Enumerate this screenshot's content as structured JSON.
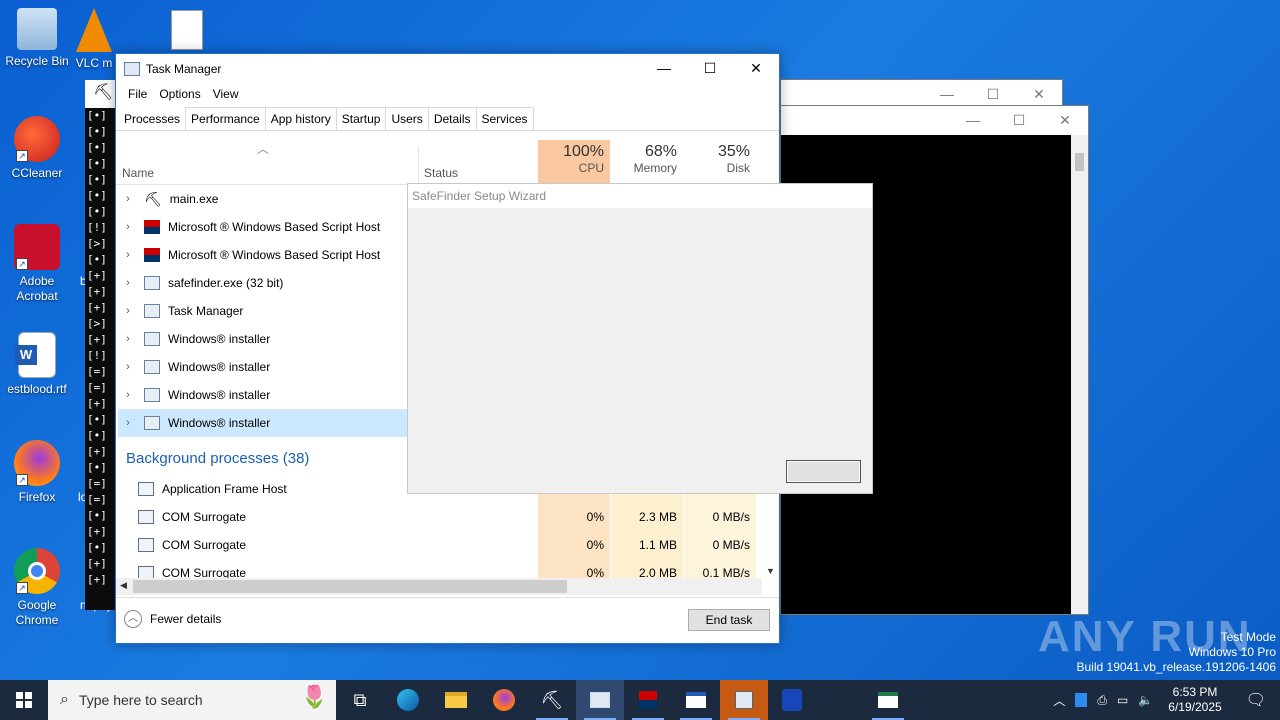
{
  "desktop": {
    "icons": [
      {
        "label": "Recycle Bin"
      },
      {
        "label": "VLC m"
      },
      {
        "label": "CCleaner"
      },
      {
        "label": "Adobe Acrobat"
      },
      {
        "label": "estblood.rtf"
      },
      {
        "label": "Firefox"
      },
      {
        "label": "Google Chrome"
      }
    ],
    "partial_labels": [
      "b",
      "lo",
      "napay"
    ]
  },
  "console": {
    "lines": [
      "[•]",
      "[•]",
      "[•]",
      "[•]",
      "[•]",
      "[•]",
      "[•]",
      "[!]",
      "[>]",
      "[•]",
      "[+]",
      "[+]",
      "[+]",
      "[>]",
      "[+]",
      "[!]",
      "[=]",
      "[=]",
      "[+]",
      "[•]",
      "[•]",
      "[+]",
      "[•]",
      "[=]",
      "[=]",
      "[•]",
      "[+]",
      "[•]",
      "[+]",
      "[+]"
    ]
  },
  "task_manager": {
    "title": "Task Manager",
    "menu": [
      "File",
      "Options",
      "View"
    ],
    "tabs": [
      "Processes",
      "Performance",
      "App history",
      "Startup",
      "Users",
      "Details",
      "Services"
    ],
    "columns": {
      "name": "Name",
      "status": "Status",
      "cpu": {
        "pct": "100%",
        "label": "CPU"
      },
      "memory": {
        "pct": "68%",
        "label": "Memory"
      },
      "disk": {
        "pct": "35%",
        "label": "Disk"
      }
    },
    "apps": [
      "main.exe",
      "Microsoft ® Windows Based Script Host",
      "Microsoft ® Windows Based Script Host",
      "safefinder.exe (32 bit)",
      "Task Manager",
      "Windows® installer",
      "Windows® installer",
      "Windows® installer",
      "Windows® installer"
    ],
    "background_header": "Background processes (38)",
    "background": [
      {
        "name": "Application Frame Host",
        "cpu": "",
        "memory": "",
        "disk": ""
      },
      {
        "name": "COM Surrogate",
        "cpu": "0%",
        "memory": "2.3 MB",
        "disk": "0 MB/s"
      },
      {
        "name": "COM Surrogate",
        "cpu": "0%",
        "memory": "1.1 MB",
        "disk": "0 MB/s"
      },
      {
        "name": "COM Surrogate",
        "cpu": "0%",
        "memory": "2.0 MB",
        "disk": "0.1 MB/s"
      }
    ],
    "fewer_details": "Fewer details",
    "end_task": "End task"
  },
  "wizard": {
    "title": "SafeFinder Setup Wizard"
  },
  "taskbar": {
    "search_placeholder": "Type here to search",
    "time": "6:53 PM",
    "date": "6/19/2025"
  },
  "watermark": {
    "brand": "ANY RUN",
    "mode": "Test Mode",
    "edition": "Windows 10 Pro",
    "build": "Build 19041.vb_release.191206-1406"
  },
  "colors": {
    "cpu_highlight": "#f7d6a8",
    "cpu_header": "#f9c8a0",
    "selected_row": "#cce8ff",
    "link_blue": "#1a5fb4"
  }
}
